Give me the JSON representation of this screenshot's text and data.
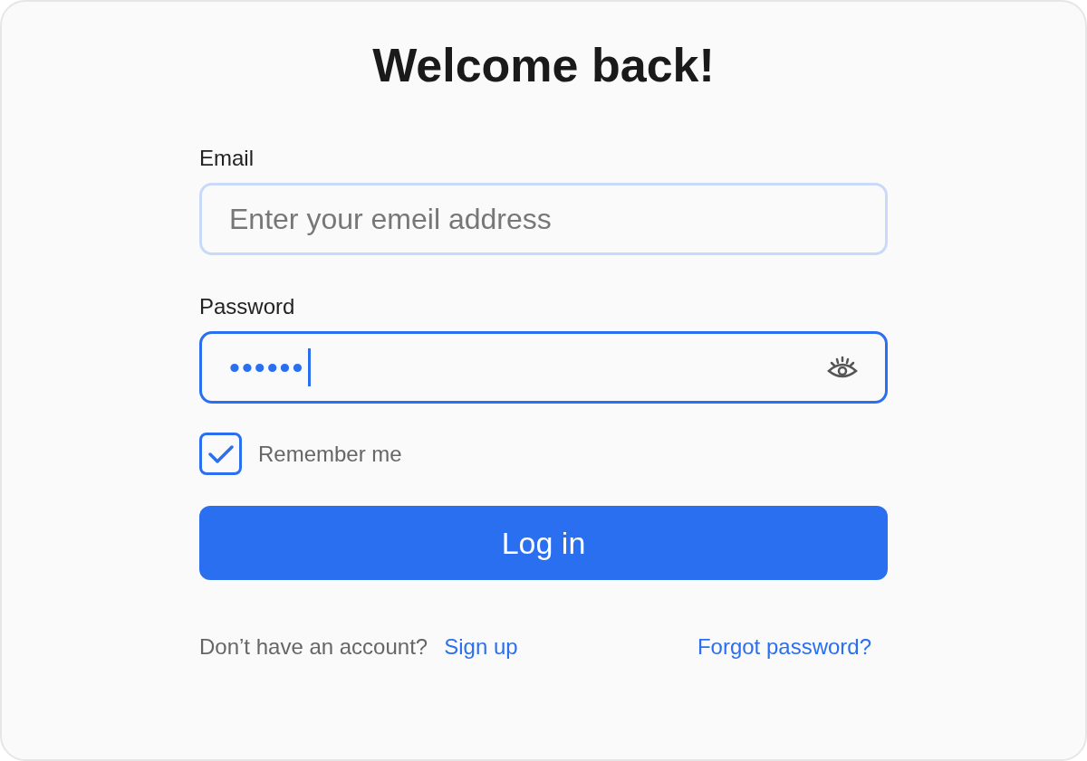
{
  "title": "Welcome back!",
  "fields": [
    {
      "label": "Email",
      "placeholder": "Enter your emeil address",
      "focused": false
    },
    {
      "label": "Password",
      "value": "••••••",
      "focused": true,
      "kind": "password"
    }
  ],
  "remember": {
    "label": "Remember me",
    "checked": true
  },
  "login_button": "Log in",
  "footer": {
    "prompt": "Don’t have an account?",
    "signup_link": "Sign up",
    "forgot_link": "Forgot password?"
  }
}
